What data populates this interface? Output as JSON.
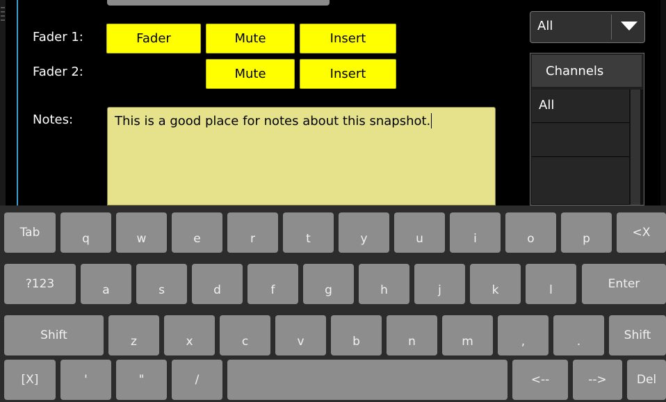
{
  "assignments": {
    "fader1_label": "Fader 1:",
    "fader2_label": "Fader 2:",
    "fader1_fader": "Fader",
    "fader1_mute": "Mute",
    "fader1_insert": "Insert",
    "fader2_mute": "Mute",
    "fader2_insert": "Insert"
  },
  "notes": {
    "label": "Notes:",
    "text": "This is a good place for notes about this snapshot."
  },
  "filter": {
    "selected": "All"
  },
  "channels": {
    "header": "Channels",
    "items": [
      "All"
    ]
  },
  "keyboard": {
    "row1": [
      "Tab",
      "q",
      "w",
      "e",
      "r",
      "t",
      "y",
      "u",
      "i",
      "o",
      "p",
      "<X"
    ],
    "row2": [
      "?123",
      "a",
      "s",
      "d",
      "f",
      "g",
      "h",
      "j",
      "k",
      "l",
      "Enter"
    ],
    "row3": [
      "Shift",
      "z",
      "x",
      "c",
      "v",
      "b",
      "n",
      "m",
      ",",
      ".",
      "Shift"
    ],
    "row4": [
      "[X]",
      "'",
      "\"",
      "/",
      "",
      "<--",
      "-->",
      "Del"
    ]
  },
  "colors": {
    "button_yellow": "#ffff00",
    "notes_bg": "#e6e28c",
    "accent_blue": "#3aa0d0",
    "key_gray": "#8d8d8d"
  }
}
